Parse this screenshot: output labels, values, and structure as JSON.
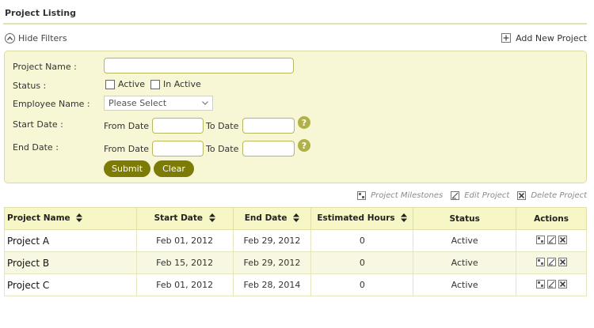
{
  "page": {
    "title": "Project Listing",
    "hide_filters": "Hide Filters",
    "add_new_project": "Add New Project"
  },
  "filters": {
    "project_name_label": "Project Name :",
    "project_name_value": "",
    "status_label": "Status :",
    "status_options": [
      "Active",
      "In Active"
    ],
    "employee_name_label": "Employee Name :",
    "employee_select_value": "Please Select",
    "start_date_label": "Start Date :",
    "end_date_label": "End Date :",
    "from_date": "From Date",
    "to_date": "To Date",
    "help": "?",
    "submit": "Submit",
    "clear": "Clear"
  },
  "toolbar": {
    "milestones": "Project Milestones",
    "edit": "Edit Project",
    "delete": "Delete Project"
  },
  "table": {
    "headers": [
      "Project Name",
      "Start Date",
      "End Date",
      "Estimated Hours",
      "Status",
      "Actions"
    ],
    "rows": [
      {
        "name": "Project A",
        "start": "Feb 01, 2012",
        "end": "Feb 29, 2012",
        "hours": "0",
        "status": "Active"
      },
      {
        "name": "Project B",
        "start": "Feb 15, 2012",
        "end": "Feb 29, 2012",
        "hours": "0",
        "status": "Active"
      },
      {
        "name": "Project C",
        "start": "Feb 01, 2012",
        "end": "Feb 28, 2014",
        "hours": "0",
        "status": "Active"
      }
    ]
  },
  "colors": {
    "accent": "#7b7b06",
    "panel_bg": "#f8f7d5",
    "header_bg": "#f6f6c6",
    "help_icon": "#b1b14a"
  },
  "icons": {
    "hide_filters": "chevron-up-circle-icon",
    "add": "plus-box-icon",
    "milestones": "milestone-icon",
    "edit": "edit-icon",
    "delete": "delete-x-icon",
    "sort": "sort-arrows-icon",
    "help": "question-circle-icon",
    "dropdown": "chevron-down-icon"
  }
}
